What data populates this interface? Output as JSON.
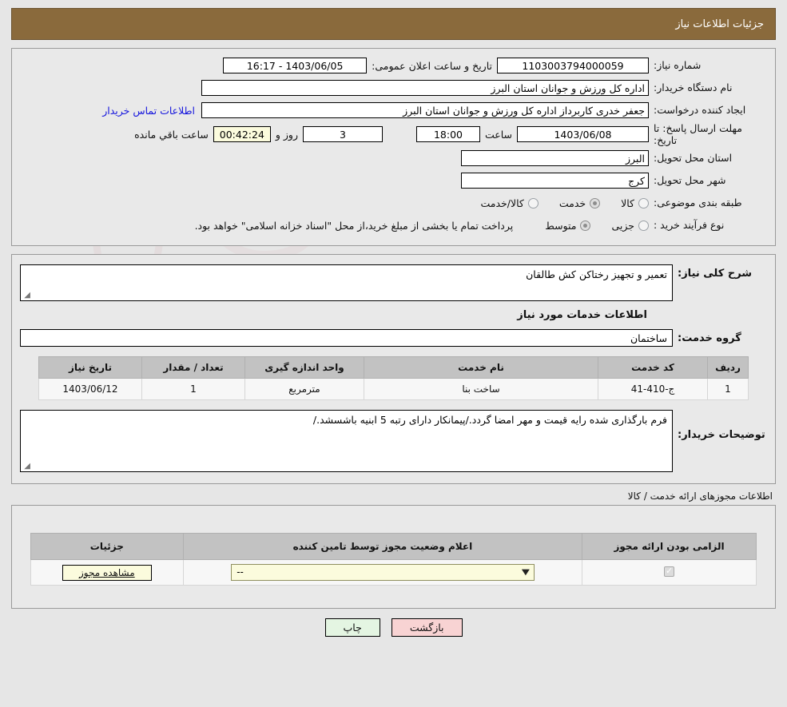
{
  "header": {
    "title": "جزئیات اطلاعات نیاز"
  },
  "summary": {
    "need_number_label": "شماره نیاز:",
    "need_number_value": "1103003794000059",
    "public_announce_label": "تاریخ و ساعت اعلان عمومی:",
    "public_announce_value": "1403/06/05 - 16:17",
    "buyer_org_label": "نام دستگاه خریدار:",
    "buyer_org_value": "اداره کل ورزش و جوانان استان البرز",
    "creator_label": "ایجاد کننده درخواست:",
    "creator_value": "جعفر خدری کاربرداز اداره کل ورزش و جوانان استان البرز",
    "contact_link": "اطلاعات تماس خریدار",
    "deadline_label": "مهلت ارسال پاسخ: تا تاریخ:",
    "deadline_date": "1403/06/08",
    "hour_label": "ساعت",
    "hour_value": "18:00",
    "days_value": "3",
    "days_label": "روز و",
    "timer_value": "00:42:24",
    "remaining_label": "ساعت باقي مانده",
    "province_label": "استان محل تحویل:",
    "province_value": "البرز",
    "city_label": "شهر محل تحویل:",
    "city_value": "کرج",
    "category_label": "طبقه بندی موضوعی:",
    "category_options": [
      {
        "label": "کالا",
        "selected": false
      },
      {
        "label": "خدمت",
        "selected": true
      },
      {
        "label": "کالا/خدمت",
        "selected": false
      }
    ],
    "process_label": "نوع فرآیند خرید :",
    "process_options": [
      {
        "label": "جزیی",
        "selected": false
      },
      {
        "label": "متوسط",
        "selected": true
      }
    ],
    "payment_note": "پرداخت تمام یا بخشی از مبلغ خرید،از محل \"اسناد خزانه اسلامی\" خواهد بود."
  },
  "details": {
    "need_desc_label": "شرح کلی نیاز:",
    "need_desc_value": "تعمیر و تجهیز رختاکن کش طالقان",
    "services_section_title": "اطلاعات خدمات مورد نیاز",
    "service_group_label": "گروه خدمت:",
    "service_group_value": "ساختمان",
    "buyer_notes_label": "توضیحات خریدار:",
    "buyer_notes_value": "فرم بارگذاری شده رایه قیمت و مهر امضا گردد./پیمانکار دارای رتبه 5 ابنیه باشسشد./"
  },
  "services_table": {
    "columns": [
      "ردیف",
      "کد خدمت",
      "نام خدمت",
      "واحد اندازه گیری",
      "تعداد / مقدار",
      "تاریخ نیاز"
    ],
    "rows": [
      {
        "row": "1",
        "code": "ج-410-41",
        "name": "ساخت بنا",
        "unit": "مترمربع",
        "qty": "1",
        "date": "1403/06/12"
      }
    ]
  },
  "licenses": {
    "caption": "اطلاعات مجوزهای ارائه خدمت / کالا",
    "columns": [
      "الزامی بودن ارائه مجوز",
      "اعلام وضعیت مجوز توسط تامین کننده",
      "جزئیات"
    ],
    "rows": [
      {
        "required": true,
        "status_value": "--",
        "details_button": "مشاهده مجوز"
      }
    ]
  },
  "footer": {
    "back_label": "بازگشت",
    "print_label": "چاپ"
  },
  "colors": {
    "header_bg": "#8a6a3c",
    "page_bg": "#e6e6e6",
    "link": "#1414dd",
    "back_btn": "#f8d3d3",
    "print_btn": "#e4f5e2",
    "table_header": "#c2c2c2",
    "field_yellow": "#fbfbdd"
  },
  "watermark": {
    "text": "AnaTender.net"
  }
}
